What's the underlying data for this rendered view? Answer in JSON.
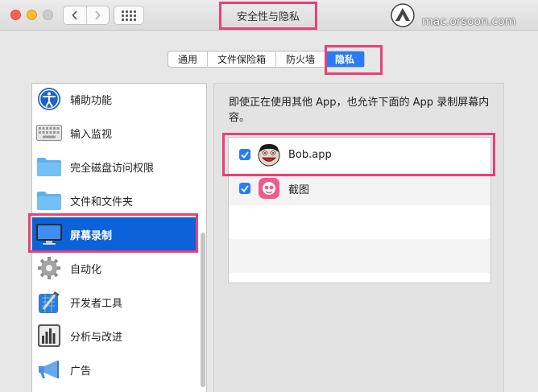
{
  "window": {
    "title": "安全性与隐私",
    "watermark_url": "mac.orsoon.com"
  },
  "tabs": [
    {
      "label": "通用",
      "active": false
    },
    {
      "label": "文件保险箱",
      "active": false
    },
    {
      "label": "防火墙",
      "active": false
    },
    {
      "label": "隐私",
      "active": true
    }
  ],
  "sidebar": {
    "items": [
      {
        "label": "辅助功能",
        "icon": "accessibility-icon",
        "selected": false
      },
      {
        "label": "输入监视",
        "icon": "keyboard-icon",
        "selected": false
      },
      {
        "label": "完全磁盘访问权限",
        "icon": "folder-icon",
        "selected": false
      },
      {
        "label": "文件和文件夹",
        "icon": "folder-icon",
        "selected": false
      },
      {
        "label": "屏幕录制",
        "icon": "monitor-icon",
        "selected": true
      },
      {
        "label": "自动化",
        "icon": "gear-icon",
        "selected": false
      },
      {
        "label": "开发者工具",
        "icon": "xcode-icon",
        "selected": false
      },
      {
        "label": "分析与改进",
        "icon": "bar-chart-icon",
        "selected": false
      },
      {
        "label": "广告",
        "icon": "megaphone-icon",
        "selected": false
      }
    ]
  },
  "main": {
    "description": "即使正在使用其他 App，也允许下面的 App 录制屏幕内容。",
    "apps": [
      {
        "name": "Bob.app",
        "checked": true,
        "icon": "bob-face-icon"
      },
      {
        "name": "截图",
        "checked": true,
        "icon": "screenshot-app-icon"
      }
    ]
  },
  "colors": {
    "accent": "#2a7cf6",
    "selection": "#0c62d8",
    "highlight_box": "#ea3f78"
  }
}
